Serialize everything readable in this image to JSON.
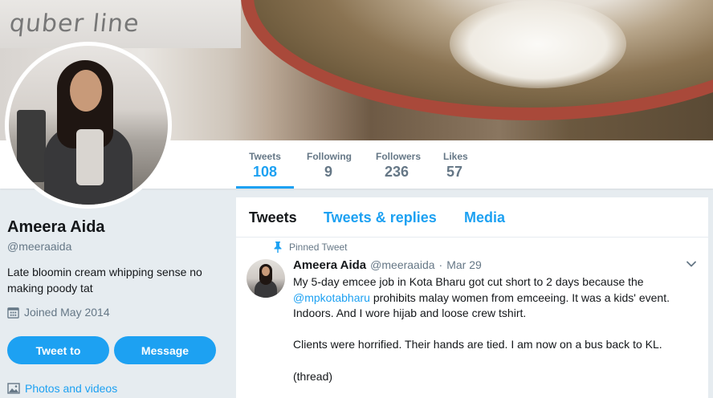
{
  "banner": {
    "brand_text": "quber line"
  },
  "stats": [
    {
      "label": "Tweets",
      "value": "108"
    },
    {
      "label": "Following",
      "value": "9"
    },
    {
      "label": "Followers",
      "value": "236"
    },
    {
      "label": "Likes",
      "value": "57"
    }
  ],
  "profile": {
    "name": "Ameera Aida",
    "handle": "@meeraaida",
    "bio": "Late bloomin cream whipping sense no making poody tat",
    "joined": "Joined May 2014",
    "tweet_to_label": "Tweet to",
    "message_label": "Message",
    "photos_label": "Photos and videos"
  },
  "tabs": [
    {
      "label": "Tweets"
    },
    {
      "label": "Tweets & replies"
    },
    {
      "label": "Media"
    }
  ],
  "tweet": {
    "pinned_label": "Pinned Tweet",
    "author_name": "Ameera Aida",
    "author_handle": "@meeraaida",
    "separator": "·",
    "date": "Mar 29",
    "line1": "My 5-day emcee job in Kota Bharu got cut short to 2 days because the",
    "mention": "@mpkotabharu",
    "line2_rest": " prohibits malay women from emceeing. It was a kids' event.",
    "line3": "Indoors. And I wore hijab and loose crew tshirt.",
    "line4": "Clients were horrified. Their hands are tied. I am now on a bus back to KL.",
    "line5": "(thread)"
  },
  "colors": {
    "accent": "#1da1f2",
    "muted": "#657786",
    "text": "#14171a",
    "background": "#e6ecf0"
  },
  "icons": [
    "calendar-icon",
    "image-icon",
    "pin-icon",
    "chevron-down-icon"
  ]
}
